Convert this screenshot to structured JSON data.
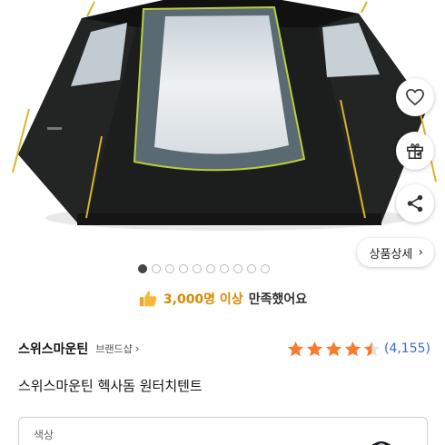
{
  "product_image": {
    "alt": "hexagon dome tent",
    "colors": {
      "body": "#1c1d1d",
      "window": "#dfe4e8",
      "trim": "#b9cf3a",
      "pole": "#d8b52a"
    }
  },
  "actions": {
    "wishlist_icon": "heart-icon",
    "gift_icon": "gift-icon",
    "share_icon": "share-icon",
    "detail_label": "상품상세"
  },
  "carousel": {
    "total": 10,
    "active_index": 0
  },
  "satisfaction": {
    "icon": "thumbs-up-icon",
    "count": "3,000명 이상",
    "text": "만족했어요"
  },
  "brand": {
    "name": "스위스마운틴",
    "shop_label": "브랜드샵"
  },
  "rating": {
    "stars": 4.5,
    "review_count": "(4,155)",
    "star_color": "#f57c2c"
  },
  "product": {
    "title": "스위스마운틴 헥사돔 원터치텐트"
  },
  "option": {
    "label": "색상"
  }
}
